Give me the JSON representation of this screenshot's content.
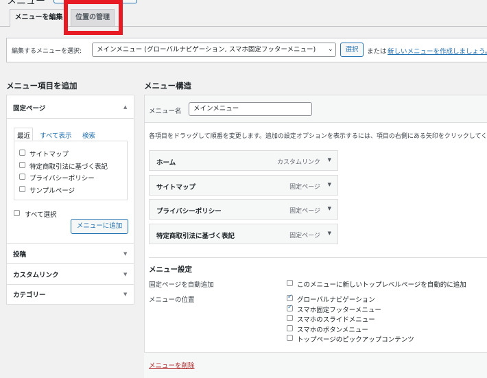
{
  "page": {
    "title": "メニュー"
  },
  "tabs": [
    {
      "label": "メニューを編集",
      "active": true
    },
    {
      "label": "位置の管理",
      "active": false
    }
  ],
  "select_bar": {
    "label": "編集するメニューを選択:",
    "selected": "メインメニュー (グローバルナビゲーション, スマホ固定フッターメニュー)",
    "button": "選択",
    "or_text": "または",
    "create_link": "新しいメニューを作成しましょう。"
  },
  "left": {
    "heading": "メニュー項目を追加",
    "fixed_pages": {
      "title": "固定ページ",
      "subtabs": [
        "最近",
        "すべて表示",
        "検索"
      ],
      "pages": [
        "サイトマップ",
        "特定商取引法に基づく表記",
        "プライバシーポリシー",
        "サンプルページ"
      ],
      "select_all": "すべて選択",
      "add_button": "メニューに追加"
    },
    "sections": [
      "投稿",
      "カスタムリンク",
      "カテゴリー"
    ]
  },
  "main": {
    "heading": "メニュー構造",
    "name_label": "メニュー名",
    "name_value": "メインメニュー",
    "instructions": "各項目をドラッグして順番を変更します。追加の設定オプションを表示するには、項目の右側にある矢印をクリックしてください。",
    "items": [
      {
        "title": "ホーム",
        "type": "カスタムリンク"
      },
      {
        "title": "サイトマップ",
        "type": "固定ページ"
      },
      {
        "title": "プライバシーポリシー",
        "type": "固定ページ"
      },
      {
        "title": "特定商取引法に基づく表記",
        "type": "固定ページ"
      }
    ],
    "settings": {
      "heading": "メニュー設定",
      "auto_add_label": "固定ページを自動追加",
      "auto_add_option": "このメニューに新しいトップレベルページを自動的に追加",
      "location_label": "メニューの位置",
      "locations": [
        {
          "label": "グローバルナビゲーション",
          "checked": true
        },
        {
          "label": "スマホ固定フッターメニュー",
          "checked": true
        },
        {
          "label": "スマホのスライドメニュー",
          "checked": false
        },
        {
          "label": "スマホのボタンメニュー",
          "checked": false
        },
        {
          "label": "トップページのピックアップコンテンツ",
          "checked": false
        }
      ]
    },
    "delete_link": "メニューを削除"
  },
  "colors": {
    "accent": "#2271b1",
    "highlight": "#e81a24",
    "danger": "#b32d2e"
  }
}
